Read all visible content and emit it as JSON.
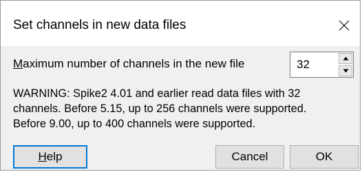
{
  "dialog": {
    "title": "Set channels in new data files",
    "close_icon": "close-icon"
  },
  "max_channels": {
    "label_accel": "M",
    "label_rest": "aximum number of channels in the new file",
    "value": "32",
    "up_icon": "spin-up-arrow-icon",
    "down_icon": "spin-down-arrow-icon"
  },
  "warning": {
    "lines": [
      "WARNING: Spike2 4.01 and earlier read data files with 32",
      "channels. Before 5.15, up to 256 channels were supported.",
      "Before 9.00, up to 400 channels were supported."
    ]
  },
  "buttons": {
    "help_accel": "H",
    "help_rest": "elp",
    "cancel": "Cancel",
    "ok": "OK"
  },
  "colors": {
    "titlebar_bg": "#ffffff",
    "client_bg": "#f0f0f0",
    "button_bg": "#e1e1e1",
    "focus_border": "#0078d7"
  }
}
